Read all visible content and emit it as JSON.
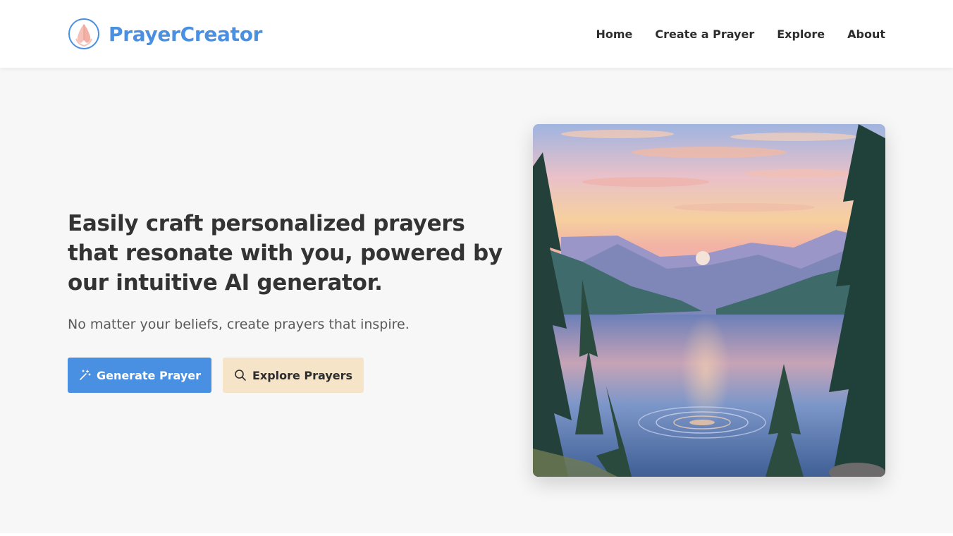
{
  "header": {
    "brand_name": "PrayerCreator",
    "logo_icon": "praying-hands-icon",
    "nav": [
      {
        "label": "Home"
      },
      {
        "label": "Create a Prayer"
      },
      {
        "label": "Explore"
      },
      {
        "label": "About"
      }
    ]
  },
  "hero": {
    "title_lines": [
      "Easily craft personalized prayers",
      "that resonate with you, powered by",
      "our intuitive AI generator."
    ],
    "subtitle": "No matter your beliefs, create prayers that inspire.",
    "primary_button": {
      "label": "Generate Prayer",
      "icon": "magic-wand-icon"
    },
    "secondary_button": {
      "label": "Explore Prayers",
      "icon": "search-icon"
    },
    "image_subject": "lake-sunset-painting"
  },
  "colors": {
    "accent": "#4a90e2",
    "secondary_button_bg": "#f6e4c8",
    "page_bg": "#f7f7f7",
    "header_bg": "#ffffff",
    "text": "#333333"
  }
}
